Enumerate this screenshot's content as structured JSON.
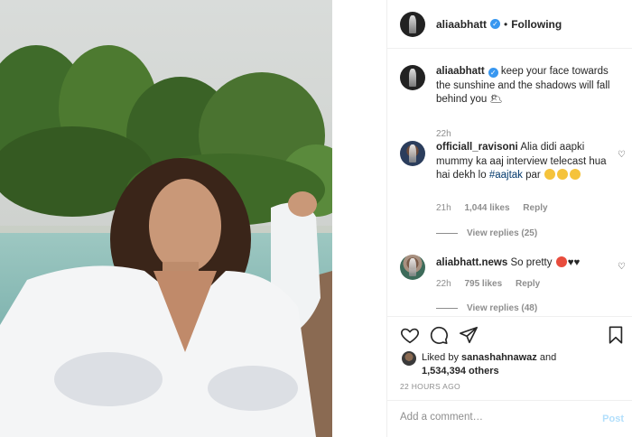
{
  "header": {
    "username": "aliaabhatt",
    "verified_mark": "✓",
    "separator": "•",
    "follow_status": "Following"
  },
  "caption": {
    "username": "aliaabhatt",
    "verified_mark": "✓",
    "text": "keep your face towards the sunshine and the shadows will fall behind you 🌥",
    "time": "22h"
  },
  "comments": [
    {
      "username": "officiall_ravisoni",
      "text_before": "Alia didi aapki mummy ka aaj interview telecast hua hai dekh lo",
      "hashtag": "#aajtak",
      "text_after": "par",
      "time": "21h",
      "likes": "1,044 likes",
      "reply": "Reply",
      "view_replies": "View replies (25)"
    },
    {
      "username": "aliabhatt.news",
      "text": "So pretty",
      "hearts": "♥♥",
      "time": "22h",
      "likes": "795 likes",
      "reply": "Reply",
      "view_replies": "View replies (48)"
    }
  ],
  "likes": {
    "prefix": "Liked by",
    "user": "sanashahnawaz",
    "and": "and",
    "others": "1,534,394 others"
  },
  "timestamp": "22 HOURS AGO",
  "add_comment": {
    "placeholder": "Add a comment…",
    "post_label": "Post"
  },
  "icons": [
    "heart-icon",
    "comment-icon",
    "share-icon",
    "bookmark-icon"
  ],
  "colors": {
    "verified": "#3897f0",
    "post_disabled": "#b2dffc",
    "hashtag": "#00376b"
  }
}
